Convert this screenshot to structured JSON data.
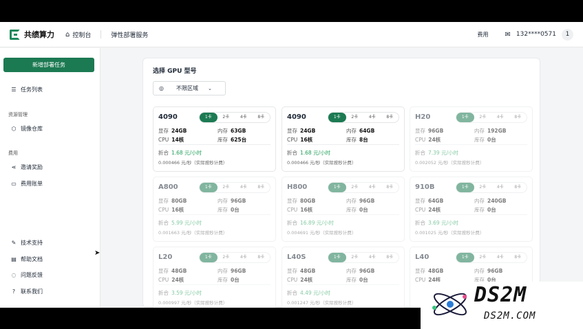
{
  "brand": {
    "name": "共绩算力",
    "accent": "#1c7a52"
  },
  "topnav": {
    "home_label": "控制台",
    "service_label": "弹性部署服务",
    "fees_label": "费用",
    "phone": "132****0571",
    "avatar_text": "1"
  },
  "sidebar": {
    "new_task_label": "新增部署任务",
    "task_list": "任务列表",
    "group_resources": "资源管理",
    "image_repo": "镜像仓库",
    "group_fees": "费用",
    "invite": "邀请奖励",
    "billing": "费用账单",
    "support": "技术支持",
    "docs": "帮助文档",
    "feedback": "问题反馈",
    "contact": "联系我们"
  },
  "main": {
    "title": "选择 GPU 型号",
    "region_value": "不限区域",
    "labels": {
      "vram": "显存",
      "mem": "内存",
      "cpu": "CPU",
      "stock": "库存",
      "discount": "折合"
    },
    "tabs": [
      "1卡",
      "2卡",
      "4卡",
      "8卡"
    ],
    "cards": [
      {
        "name": "4090",
        "vram": "24GB",
        "mem": "63GB",
        "cpu": "14核",
        "stock": "625台",
        "hourly": "1.68 元/小时",
        "per_sec": "0.000466 元/秒（实际按秒计费）",
        "available": true
      },
      {
        "name": "4090",
        "vram": "24GB",
        "mem": "64GB",
        "cpu": "16核",
        "stock": "8台",
        "hourly": "1.68 元/小时",
        "per_sec": "0.000466 元/秒（实际按秒计费）",
        "available": true
      },
      {
        "name": "H20",
        "vram": "96GB",
        "mem": "192GB",
        "cpu": "24核",
        "stock": "0台",
        "hourly": "7.39 元/小时",
        "per_sec": "0.002052 元/秒（实际按秒计费）",
        "available": false
      },
      {
        "name": "A800",
        "vram": "80GB",
        "mem": "96GB",
        "cpu": "16核",
        "stock": "0台",
        "hourly": "5.99 元/小时",
        "per_sec": "0.001663 元/秒（实际按秒计费）",
        "available": false
      },
      {
        "name": "H800",
        "vram": "80GB",
        "mem": "96GB",
        "cpu": "16核",
        "stock": "0台",
        "hourly": "16.89 元/小时",
        "per_sec": "0.004691 元/秒（实际按秒计费）",
        "available": false
      },
      {
        "name": "910B",
        "vram": "64GB",
        "mem": "240GB",
        "cpu": "24核",
        "stock": "0台",
        "hourly": "3.69 元/小时",
        "per_sec": "0.001025 元/秒（实际按秒计费）",
        "available": false
      },
      {
        "name": "L20",
        "vram": "48GB",
        "mem": "96GB",
        "cpu": "24核",
        "stock": "0台",
        "hourly": "3.59 元/小时",
        "per_sec": "0.000997 元/秒（实际按秒计费）",
        "available": false
      },
      {
        "name": "L40S",
        "vram": "48GB",
        "mem": "96GB",
        "cpu": "24核",
        "stock": "0台",
        "hourly": "4.49 元/小时",
        "per_sec": "0.001247 元/秒（实际按秒计费）",
        "available": false
      },
      {
        "name": "L40",
        "vram": "48GB",
        "mem": "96GB",
        "cpu": "24核",
        "stock": "0台",
        "hourly": "",
        "per_sec": "",
        "available": false
      }
    ]
  },
  "watermark": {
    "big": "DS2M",
    "small": "DS2M.COM"
  }
}
